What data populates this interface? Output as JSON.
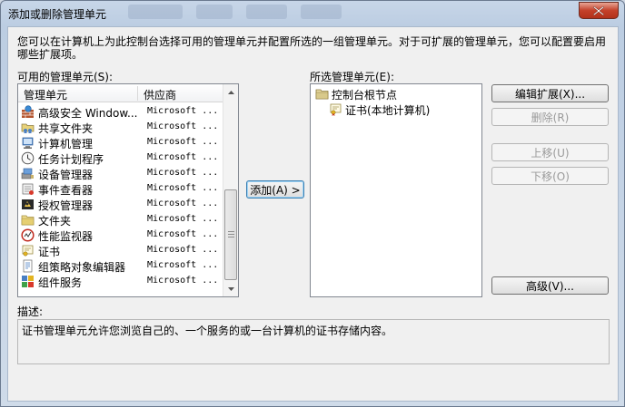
{
  "window": {
    "title": "添加或删除管理单元"
  },
  "intro": "您可以在计算机上为此控制台选择可用的管理单元并配置所选的一组管理单元。对于可扩展的管理单元，您可以配置要启用哪些扩展项。",
  "available": {
    "label": "可用的管理单元(S):",
    "headers": {
      "name": "管理单元",
      "vendor": "供应商"
    },
    "items": [
      {
        "name": "高级安全 Window...",
        "vendor": "Microsoft ...",
        "icon": "firewall-icon"
      },
      {
        "name": "共享文件夹",
        "vendor": "Microsoft ...",
        "icon": "shared-folder-icon"
      },
      {
        "name": "计算机管理",
        "vendor": "Microsoft ...",
        "icon": "computer-management-icon"
      },
      {
        "name": "任务计划程序",
        "vendor": "Microsoft ...",
        "icon": "clock-icon"
      },
      {
        "name": "设备管理器",
        "vendor": "Microsoft ...",
        "icon": "device-manager-icon"
      },
      {
        "name": "事件查看器",
        "vendor": "Microsoft ...",
        "icon": "event-viewer-icon"
      },
      {
        "name": "授权管理器",
        "vendor": "Microsoft ...",
        "icon": "authorization-icon"
      },
      {
        "name": "文件夹",
        "vendor": "Microsoft ...",
        "icon": "folder-icon"
      },
      {
        "name": "性能监视器",
        "vendor": "Microsoft ...",
        "icon": "performance-monitor-icon"
      },
      {
        "name": "证书",
        "vendor": "Microsoft ...",
        "icon": "certificate-icon"
      },
      {
        "name": "组策略对象编辑器",
        "vendor": "Microsoft ...",
        "icon": "group-policy-icon"
      },
      {
        "name": "组件服务",
        "vendor": "Microsoft ...",
        "icon": "component-services-icon"
      }
    ]
  },
  "add_button": "添加(A) >",
  "selected": {
    "label": "所选管理单元(E):",
    "root": "控制台根节点",
    "child": "证书(本地计算机)"
  },
  "buttons": {
    "edit_extensions": "编辑扩展(X)...",
    "remove": "删除(R)",
    "move_up": "上移(U)",
    "move_down": "下移(O)",
    "advanced": "高级(V)..."
  },
  "description": {
    "label": "描述:",
    "text": "证书管理单元允许您浏览自己的、一个服务的或一台计算机的证书存储内容。"
  },
  "colors": {
    "titlebar": "#c7d6e8",
    "close": "#c4412a",
    "client": "#f0f0f0"
  }
}
